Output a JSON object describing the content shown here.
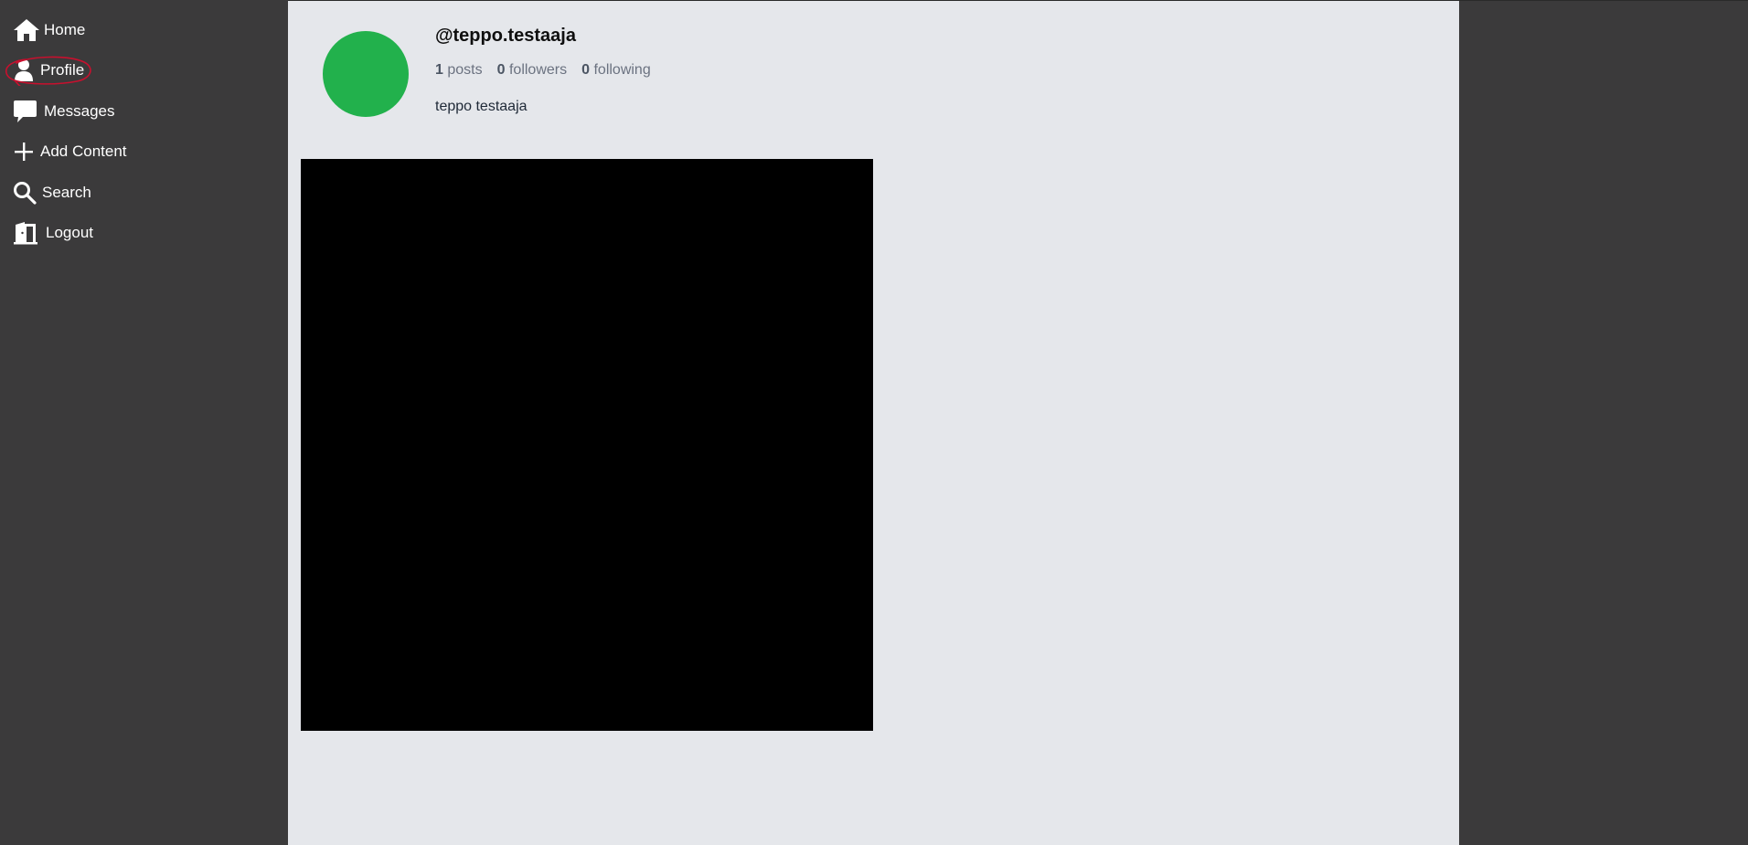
{
  "sidebar": {
    "items": [
      {
        "label": "Home",
        "icon": "home-icon"
      },
      {
        "label": "Profile",
        "icon": "user-icon",
        "active": true
      },
      {
        "label": "Messages",
        "icon": "message-icon"
      },
      {
        "label": "Add Content",
        "icon": "plus-icon"
      },
      {
        "label": "Search",
        "icon": "search-icon"
      },
      {
        "label": "Logout",
        "icon": "logout-door-icon"
      }
    ]
  },
  "profile": {
    "username": "@teppo.testaaja",
    "posts_count": "1",
    "posts_label": "posts",
    "followers_count": "0",
    "followers_label": "followers",
    "following_count": "0",
    "following_label": "following",
    "bio": "teppo testaaja",
    "avatar_color": "#22b14c"
  },
  "posts": [
    {
      "color": "#000000"
    }
  ],
  "colors": {
    "sidebar_bg": "#3b3a3b",
    "main_bg": "#e5e7eb",
    "highlight_annotation": "#c8102e"
  }
}
